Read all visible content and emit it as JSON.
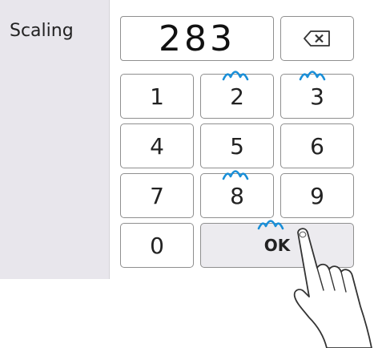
{
  "panel": {
    "setting_label": "Scaling"
  },
  "display": {
    "value": "283"
  },
  "keypad": {
    "keys": [
      "1",
      "2",
      "3",
      "4",
      "5",
      "6",
      "7",
      "8",
      "9",
      "0"
    ],
    "ok_label": "OK"
  },
  "icons": {
    "backspace": "backspace-icon",
    "tap_indicator": "tap-indicator-icon",
    "pointer_hand": "pointing-hand-icon"
  },
  "colors": {
    "tap_indicator": "#1a8fd8",
    "key_border": "#8f8f8f",
    "panel_background": "#e8e6ec",
    "ok_key_background": "#ecebef"
  }
}
